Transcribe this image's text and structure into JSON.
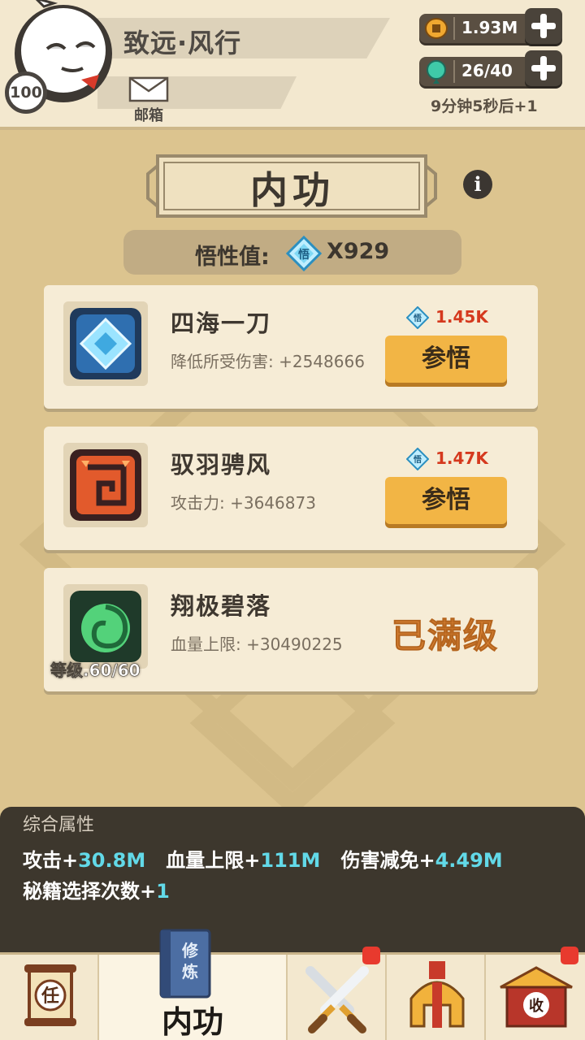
{
  "player": {
    "name": "致远·风行",
    "level": "100",
    "mail_label": "邮箱"
  },
  "resources": {
    "coins": "1.93M",
    "energy": "26/40",
    "energy_timer": "9分钟5秒后+1"
  },
  "page": {
    "title": "内功",
    "wuxing_label": "悟性值:",
    "wuxing_value": "X929"
  },
  "skills": [
    {
      "name": "四海一刀",
      "bonus": "降低所受伤害: +2548666",
      "cost": "1.45K",
      "button": "参悟"
    },
    {
      "name": "驭羽骋风",
      "bonus": "攻击力: +3646873",
      "cost": "1.47K",
      "button": "参悟"
    },
    {
      "name": "翔极碧落",
      "bonus": "血量上限: +30490225",
      "status": "已满级",
      "level": "等级.60/60"
    }
  ],
  "attributes": {
    "title": "综合属性",
    "attack_label": "攻击+",
    "attack_value": "30.8M",
    "hp_label": "血量上限+",
    "hp_value": "111M",
    "dr_label": "伤害减免+",
    "dr_value": "4.49M",
    "picks_label": "秘籍选择次数+",
    "picks_value": "1"
  },
  "nav": {
    "task_label": "任",
    "book_label": "修炼",
    "active_label": "内功",
    "shop_label": "收"
  },
  "colors": {
    "background": "#dcc48f",
    "card": "#f6ecd6",
    "button": "#f2b545",
    "cost_red": "#d5391e",
    "attr_cyan": "#62d9e8",
    "maxed_orange": "#e28a3a"
  }
}
